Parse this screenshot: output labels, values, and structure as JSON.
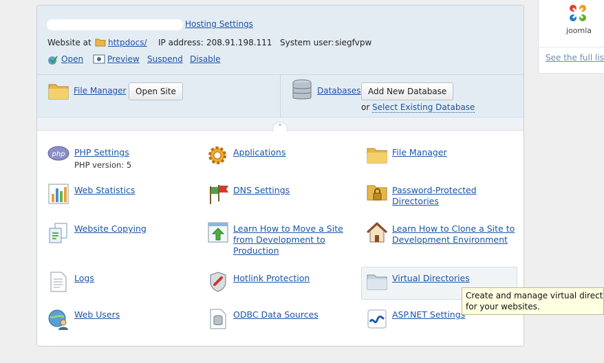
{
  "header": {
    "hosting_settings": "Hosting Settings",
    "website_at": "Website at",
    "httpdocs": "httpdocs/",
    "ip_label": "IP address:",
    "ip_value": "208.91.198.111",
    "sysuser_label": "System user:",
    "sysuser_value": "siegfvpw",
    "actions": {
      "open": "Open",
      "preview": "Preview",
      "suspend": "Suspend",
      "disable": "Disable"
    }
  },
  "quick": {
    "file_manager": "File Manager",
    "open_site": "Open Site",
    "databases": "Databases",
    "add_db": "Add New Database",
    "or": "or",
    "select_db": "Select Existing Database"
  },
  "grid": {
    "php_settings": "PHP Settings",
    "php_version": "PHP version: 5",
    "applications": "Applications",
    "file_manager": "File Manager",
    "web_statistics": "Web Statistics",
    "dns_settings": "DNS Settings",
    "pwd_dirs_1": "Password-Protected",
    "pwd_dirs_2": "Directories",
    "website_copying": "Website Copying",
    "learn_move_1": "Learn How to Move a Site",
    "learn_move_2": "from Development to",
    "learn_move_3": "Production",
    "learn_clone_1": "Learn How to Clone a Site to",
    "learn_clone_2": "Development Environment",
    "logs": "Logs",
    "hotlink": "Hotlink Protection",
    "virtual_dirs": "Virtual Directories",
    "web_users": "Web Users",
    "odbc": "ODBC Data Sources",
    "aspnet": "ASP.NET Settings"
  },
  "tooltip": {
    "line1": "Create and manage virtual directo",
    "line2": "for your websites."
  },
  "side": {
    "app_name": "joomla",
    "see_full": "See the full list"
  },
  "icons": {
    "php": "php",
    "applications": "gear-icon",
    "folder": "folder-icon",
    "stats": "bar-chart-icon",
    "dns": "flags-icon",
    "lock_folder": "locked-folder-icon",
    "copy": "copy-icon",
    "move": "upload-arrow-icon",
    "house": "house-icon",
    "logs": "document-icon",
    "hotlink": "shield-icon",
    "virtual": "folder-icon",
    "users": "globe-user-icon",
    "odbc": "database-icon",
    "aspnet": "aspnet-icon"
  },
  "colors": {
    "link": "#1a54a6",
    "header_bg": "#e4ecf3",
    "tooltip_bg": "#ffffe1"
  }
}
